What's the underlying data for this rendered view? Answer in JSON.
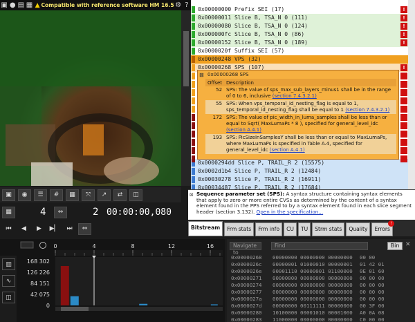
{
  "toolbar": {
    "compat_text": "Compatible with reference software HM 16.5",
    "help": "?"
  },
  "video": {
    "frame_counter": "4",
    "frame_total": "2",
    "timecode": "00:00:00,080"
  },
  "nal_rows": [
    {
      "text": "0x00000000 Prefix SEI (17)",
      "kind": "sei",
      "error": true
    },
    {
      "text": "0x00000011 Slice B, TSA_N 0 (111)",
      "kind": "sliceb",
      "error": true
    },
    {
      "text": "0x00000080 Slice B, TSA_N 0 (124)",
      "kind": "sliceb",
      "error": true
    },
    {
      "text": "0x000000fc Slice B, TSA_N 0 (86)",
      "kind": "sliceb",
      "error": true
    },
    {
      "text": "0x00000152 Slice B, TSA_N 0 (189)",
      "kind": "sliceb",
      "error": true
    },
    {
      "text": "0x0000020f Suffix SEI (57)",
      "kind": "sei",
      "error": false
    },
    {
      "text": "0x00000248 VPS (32)",
      "kind": "vps",
      "error": false
    },
    {
      "text": "0x00000268 SPS (107)",
      "kind": "sps",
      "error": true
    },
    {
      "text": "0x0000294dd Slice P, TRAIL_R 2 (15575)",
      "kind": "slicep",
      "error": false
    },
    {
      "text": "0x0002d1b4 Slice P, TRAIL_R 2 (12484)",
      "kind": "slicep",
      "error": false
    },
    {
      "text": "0x00030278 Slice P, TRAIL_R 2 (16911)",
      "kind": "slicep",
      "error": false
    },
    {
      "text": "0x00034487 Slice P, TRAIL_R 2 (17684)",
      "kind": "slicep",
      "error": false
    }
  ],
  "tooltip": {
    "title": "0x00000268 SPS",
    "col_offset": "Offset",
    "col_description": "Description",
    "entries": [
      {
        "offset": "52",
        "text": "SPS: The value of sps_max_sub_layers_minus1 shall be in the range of 0 to 6, inclusive",
        "link": "(section 7.4.3.2.1)"
      },
      {
        "offset": "55",
        "text": "SPS: When vps_temporal_id_nesting_flag is equal to 1, sps_temporal_id_nesting_flag shall be equal to 1",
        "link": "(section 7.4.3.2.1)"
      },
      {
        "offset": "172",
        "text": "SPS: The value of pic_width_in_luma_samples shall be less than or equal to Sqrt( MaxLumaPs * 8 ), specified for general_level_idc",
        "link": "(section A.4.1)"
      },
      {
        "offset": "193",
        "text": "SPS: PicSizeInSamplesY shall be less than or equal to MaxLumaPs, where MaxLumaPs is specified in Table A.4, specified for general_level_idc",
        "link": "(section A.4.1)"
      }
    ]
  },
  "description": {
    "heading": "Sequence parameter set (SPS):",
    "body": "A syntax structure containing syntax elements that apply to zero or more entire CVSs as determined by the content of a syntax element found in the PPS referred to by a syntax element found in each slice segment header (section 3.132).",
    "link": "Open in the specification..."
  },
  "tabs": [
    {
      "label": "Bitstream",
      "active": true
    },
    {
      "label": "Frm stats",
      "active": false
    },
    {
      "label": "Frm info",
      "active": false
    },
    {
      "label": "CU",
      "active": false
    },
    {
      "label": "TU",
      "active": false
    },
    {
      "label": "Strm stats",
      "active": false
    },
    {
      "label": "Quality",
      "active": false
    },
    {
      "label": "Errors",
      "active": false,
      "badge": "!"
    }
  ],
  "chart_data": {
    "type": "bar",
    "x_ticks": [
      "0",
      "4",
      "8",
      "12",
      "16"
    ],
    "y_ticks": [
      "168 302",
      "126 226",
      "84 151",
      "42 075",
      "0"
    ],
    "ylim": [
      0,
      168302
    ],
    "values": [
      0,
      150000,
      35000,
      0,
      0,
      0,
      0,
      0,
      0,
      0,
      0,
      0,
      0,
      0,
      0,
      0,
      0,
      0,
      0,
      0
    ]
  },
  "hex": {
    "navigate_placeholder": "Navigate to",
    "find_placeholder": "Find",
    "bin_label": "Bin",
    "rows": [
      {
        "addr": "0x00000268",
        "bits": "00000000 00000000 00000000",
        "hex": "00 00"
      },
      {
        "addr": "0x0000026c",
        "bits": "00000001 01000010 00000001",
        "hex": "01 42 01"
      },
      {
        "addr": "0x0000026e",
        "bits": "00001110 00000001 01100000",
        "hex": "0E 01 60"
      },
      {
        "addr": "0x00000271",
        "bits": "00000000 00000000 00000000",
        "hex": "00 00 00"
      },
      {
        "addr": "0x00000274",
        "bits": "00000000 00000000 00000000",
        "hex": "00 00 00"
      },
      {
        "addr": "0x00000277",
        "bits": "00000000 00000000 00000000",
        "hex": "00 00 00"
      },
      {
        "addr": "0x0000027a",
        "bits": "00000000 00000000 00000000",
        "hex": "00 00 00"
      },
      {
        "addr": "0x0000027d",
        "bits": "00000000 00111111 00000000",
        "hex": "00 3F 00"
      },
      {
        "addr": "0x00000280",
        "bits": "10100000 00001010 00001000",
        "hex": "A0 0A 08"
      },
      {
        "addr": "0x00000283",
        "bits": "11000000 00000000 00000000",
        "hex": "C0 00 00"
      }
    ]
  },
  "colors": {
    "sei": "#2eaa2e",
    "sliceb": "#dff2d8",
    "vps": "#f0a020",
    "sps": "#fbe0b8",
    "slicep": "#cfe3f7",
    "error": "#d01010"
  }
}
